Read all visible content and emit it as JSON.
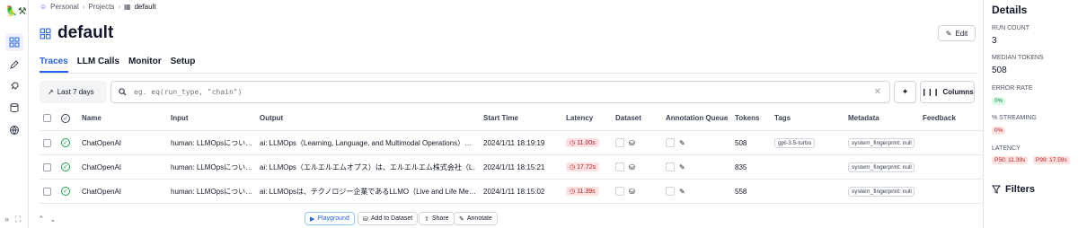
{
  "app": {
    "logo": "🦜⚒"
  },
  "breadcrumb": {
    "items": [
      "Personal",
      "Projects"
    ],
    "current": "default"
  },
  "page": {
    "title": "default",
    "edit_label": "Edit"
  },
  "tabs": [
    "Traces",
    "LLM Calls",
    "Monitor",
    "Setup"
  ],
  "toolbar": {
    "date_label": "Last 7 days",
    "search_placeholder": "eg. eq(run_type, \"chain\")",
    "columns_label": "Columns"
  },
  "table": {
    "headers": [
      "Name",
      "Input",
      "Output",
      "Start Time",
      "Latency",
      "Dataset",
      "Annotation Queue",
      "Tokens",
      "Tags",
      "Metadata",
      "Feedback"
    ],
    "rows": [
      {
        "name": "ChatOpenAI",
        "input": "human: LLMOpsについ…",
        "output": "ai: LLMOps（Learning, Language, and Multimodal Operations）…",
        "start": "2024/1/11 18:19:19",
        "latency": "11.00s",
        "tokens": "508",
        "tag": "gpt-3.5-turbo",
        "meta": "system_fingerprint: null"
      },
      {
        "name": "ChatOpenAI",
        "input": "human: LLMOpsについ…",
        "output": "ai: LLMOps（エルエルエムオプス）は、エルエルエム株式会社（L…",
        "start": "2024/1/11 18:15:21",
        "latency": "17.72s",
        "tokens": "835",
        "tag": "",
        "meta": "system_fingerprint: null"
      },
      {
        "name": "ChatOpenAI",
        "input": "human: LLMOpsについ…",
        "output": "ai: LLMOpsは、テクノロジー企業であるLLMO（Live and Life Me…",
        "start": "2024/1/11 18:15:02",
        "latency": "11.39s",
        "tokens": "558",
        "tag": "",
        "meta": "system_fingerprint: null"
      }
    ]
  },
  "bottom_bar": {
    "playground": "Playground",
    "add_dataset": "Add to Dataset",
    "share": "Share",
    "annotate": "Annotate"
  },
  "details": {
    "title": "Details",
    "run_count_label": "RUN COUNT",
    "run_count": "3",
    "median_tokens_label": "MEDIAN TOKENS",
    "median_tokens": "508",
    "error_rate_label": "ERROR RATE",
    "error_rate": "0%",
    "streaming_label": "% STREAMING",
    "streaming": "0%",
    "latency_label": "LATENCY",
    "p50": "P50: 11.39s",
    "p99": "P99: 17.59s",
    "filters_label": "Filters"
  },
  "colors": {
    "accent": "#2563eb",
    "success": "#16a34a",
    "error_bg": "#fee2e2",
    "error_text": "#b91c1c"
  }
}
